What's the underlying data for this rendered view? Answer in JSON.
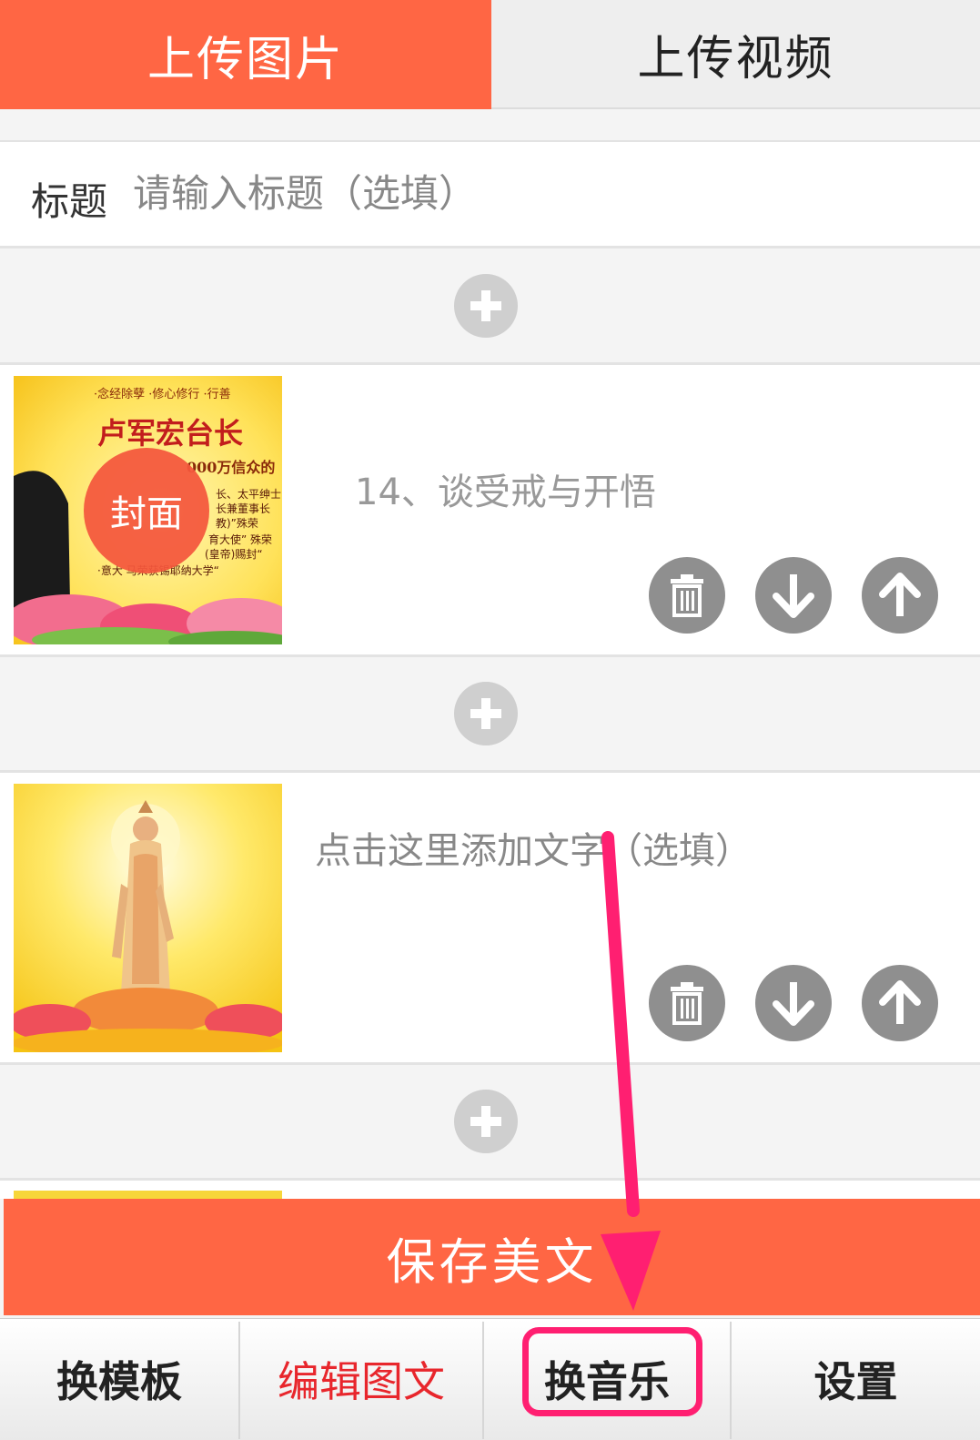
{
  "tabs": [
    {
      "label": "上传图片",
      "active": true
    },
    {
      "label": "上传视频",
      "active": false
    }
  ],
  "title_field": {
    "label": "标题",
    "placeholder": "请输入标题（选填）"
  },
  "items": [
    {
      "caption": "14、谈受戒与开悟",
      "is_cover": true,
      "cover_label": "封面",
      "poster": {
        "top_line": "·念经除孽 ·修心修行 ·行善",
        "heading": "卢军宏台长",
        "sub": "000万信众的",
        "lines": [
          "长、太平绅士",
          "长兼董事长",
          "教)”殊荣",
          "育大使” 殊荣",
          "(皇帝)赐封“",
          "·意大  马荣获锡耶纳大学“"
        ]
      }
    },
    {
      "caption": "点击这里添加文字（选填）",
      "is_cover": false
    }
  ],
  "icons": {
    "add": "plus-icon",
    "delete": "trash-icon",
    "move_down": "arrow-down-icon",
    "move_up": "arrow-up-icon"
  },
  "save_button": {
    "label": "保存美文"
  },
  "bottom_nav": [
    {
      "label": "换模板",
      "color": "#222222"
    },
    {
      "label": "编辑图文",
      "color": "#e8262c"
    },
    {
      "label": "换音乐",
      "color": "#222222",
      "highlighted": true
    },
    {
      "label": "设置",
      "color": "#222222"
    }
  ],
  "colors": {
    "accent": "#ff6644",
    "highlight": "#ff1f71",
    "active_nav": "#e8262c",
    "icon_gray": "#8f8f8f"
  }
}
